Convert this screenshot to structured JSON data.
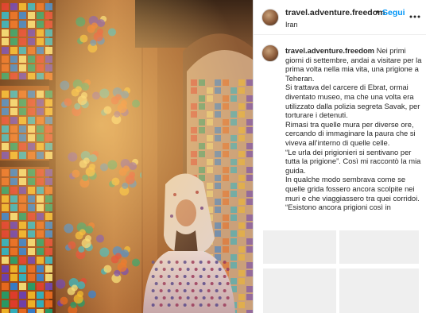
{
  "post": {
    "username": "travel.adventure.freedom",
    "separator": "•",
    "follow_label": "Segui",
    "location": "Iran",
    "more_icon": "more-horizontal-icon"
  },
  "caption": {
    "username": "travel.adventure.freedom",
    "first_text": "Nei primi giorni di settembre, andai a visitare per la prima volta nella mia vita, una prigione a Teheran.",
    "paragraphs": [
      "Si trattava del carcere di Ebrat, ormai diventato museo, ma che una volta era utilizzato dalla polizia segreta Savak, per torturare i detenuti.",
      "Rimasi tra quelle mura per diverse ore, cercando di immaginare la paura che si viveva all’interno di quelle celle.",
      "“Le urla dei prigionieri si sentivano per tutta la prigione”. Così mi raccontò la mia guida.",
      "In qualche modo sembrava come se quelle grida fossero ancora scolpite nei muri e che viaggiassero tra quei corridoi.",
      "“Esistono ancora prigioni così in"
    ]
  },
  "colors": {
    "follow": "#0095f6",
    "text": "#262626",
    "placeholder": "#efefef",
    "border": "#dbdbdb"
  },
  "photo": {
    "subject": "woman in floral headscarf standing in mosque hall lit through stained glass windows"
  }
}
